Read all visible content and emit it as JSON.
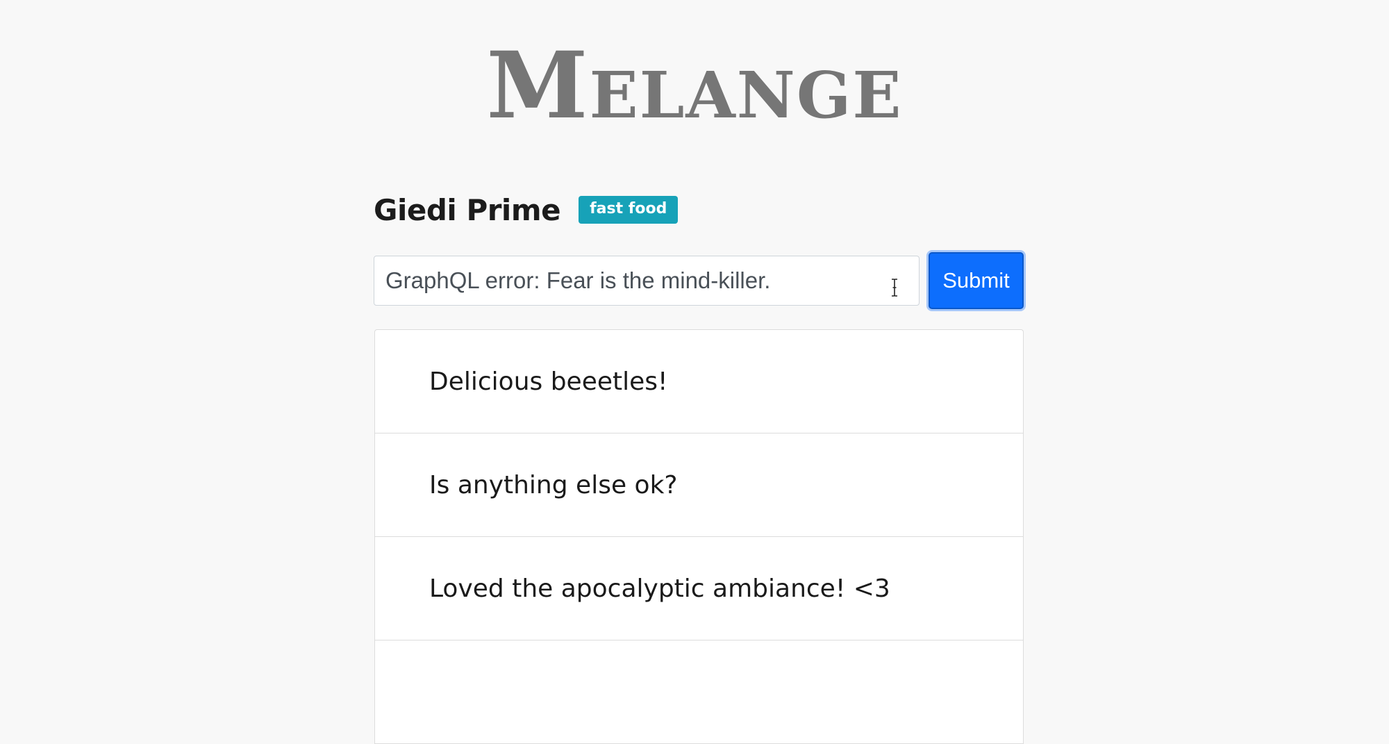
{
  "app": {
    "logo_text": "Melange"
  },
  "restaurant": {
    "name": "Giedi Prime",
    "category_badge": "fast food"
  },
  "review_form": {
    "input_value": "GraphQL error: Fear is the mind-killer.",
    "submit_label": "Submit"
  },
  "reviews": [
    {
      "text": "Delicious beeetles!"
    },
    {
      "text": "Is anything else ok?"
    },
    {
      "text": "Loved the apocalyptic ambiance! <3"
    }
  ],
  "colors": {
    "background": "#f8f8f8",
    "logo": "#767676",
    "badge": "#17a2b8",
    "submit_button": "#0d6efd"
  },
  "icons": {
    "cursor": "text-cursor-icon"
  }
}
